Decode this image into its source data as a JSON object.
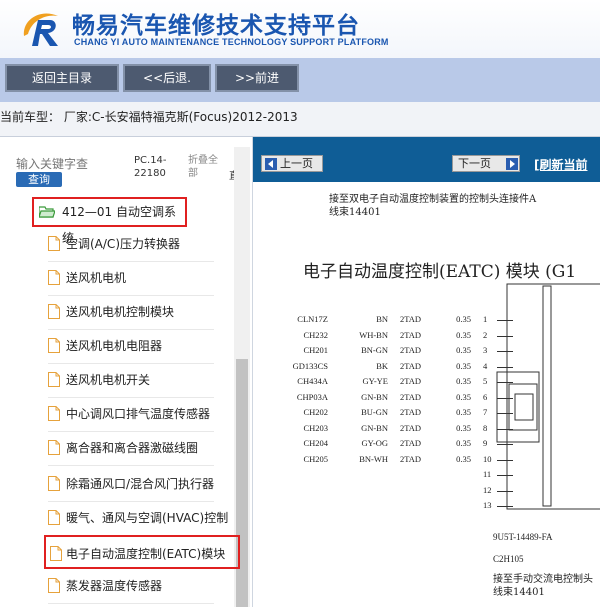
{
  "header": {
    "title": "畅易汽车维修技术支持平台",
    "subtitle": "CHANG YI AUTO MAINTENANCE TECHNOLOGY SUPPORT PLATFORM",
    "colors": {
      "brand": "#1a56b0",
      "toolbar": "#b9c9e8",
      "button": "#4d5a70",
      "accent_red": "#e02020"
    }
  },
  "toolbar": {
    "home_label": "返回主目录",
    "back_label": "<<后退.",
    "forward_label": ">>前进"
  },
  "carbar": {
    "text": "当前车型：  厂家:C-长安福特福克斯(Focus)2012-2013"
  },
  "left": {
    "search_placeholder": "输入关键字查",
    "search_button": "查询",
    "pc_text": "PC.14-22180",
    "fold_text": "折叠全部",
    "fold_cut": "直",
    "tree_root": "412—01 自动空调系统",
    "items": [
      "空调(A/C)压力转换器",
      "送风机电机",
      "送风机电机控制模块",
      "送风机电机电阻器",
      "送风机电机开关",
      "中心调风口排气温度传感器",
      "离合器和离合器激磁线圈",
      "除霜通风口/混合风门执行器",
      "暖气、通风与空调(HVAC)控制",
      "电子自动温度控制(EATC)模块",
      "蒸发器温度传感器"
    ],
    "selected_index": 9
  },
  "right": {
    "prev_label": "上一页",
    "next_label": "下一页",
    "refresh_label": "[刷新当前",
    "note_line1": "接至双电子自动温度控制装置的控制头连接件A",
    "note_line2": "线束14401",
    "module_title": "电子自动温度控制(EATC) 模块 (G1",
    "pins": [
      {
        "circuit": "CLN17Z",
        "color": "BN",
        "size": "2TAD",
        "gauge": "0.35",
        "pin": "1"
      },
      {
        "circuit": "CH232",
        "color": "WH-BN",
        "size": "2TAD",
        "gauge": "0.35",
        "pin": "2"
      },
      {
        "circuit": "CH201",
        "color": "BN-GN",
        "size": "2TAD",
        "gauge": "0.35",
        "pin": "3"
      },
      {
        "circuit": "GD133CS",
        "color": "BK",
        "size": "2TAD",
        "gauge": "0.35",
        "pin": "4"
      },
      {
        "circuit": "CH434A",
        "color": "GY-YE",
        "size": "2TAD",
        "gauge": "0.35",
        "pin": "5"
      },
      {
        "circuit": "CHP03A",
        "color": "GN-BN",
        "size": "2TAD",
        "gauge": "0.35",
        "pin": "6"
      },
      {
        "circuit": "CH202",
        "color": "BU-GN",
        "size": "2TAD",
        "gauge": "0.35",
        "pin": "7"
      },
      {
        "circuit": "CH203",
        "color": "GN-BN",
        "size": "2TAD",
        "gauge": "0.35",
        "pin": "8"
      },
      {
        "circuit": "CH204",
        "color": "GY-OG",
        "size": "2TAD",
        "gauge": "0.35",
        "pin": "9"
      },
      {
        "circuit": "CH205",
        "color": "BN-WH",
        "size": "2TAD",
        "gauge": "0.35",
        "pin": "10"
      },
      {
        "circuit": "",
        "color": "",
        "size": "",
        "gauge": "",
        "pin": "11"
      },
      {
        "circuit": "",
        "color": "",
        "size": "",
        "gauge": "",
        "pin": "12"
      },
      {
        "circuit": "",
        "color": "",
        "size": "",
        "gauge": "",
        "pin": "13"
      }
    ],
    "part_number": "9U5T-14489-FA",
    "connector_id": "C2H105",
    "note_line3": "接至手动交流电控制头",
    "note_line4": "线束14401"
  }
}
